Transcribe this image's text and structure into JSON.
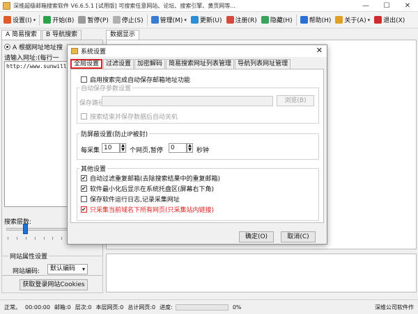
{
  "window": {
    "title": "深维超级邮箱搜索软件 V6.6.5.1 [试用版] 可搜索任意网站、论坛、搜索引擎、黄页网等...",
    "controls": [
      "—",
      "☐",
      "✕"
    ]
  },
  "toolbar": [
    {
      "label": "设置(I)",
      "icon": "settings-icon",
      "color": "#e05a2a",
      "dropdown": true
    },
    {
      "label": "开始(B)",
      "icon": "play-icon",
      "color": "#2aa34a",
      "dropdown": false
    },
    {
      "label": "暂停(P)",
      "icon": "pause-icon",
      "color": "#9a9a9a",
      "dropdown": false
    },
    {
      "label": "停止(S)",
      "icon": "stop-icon",
      "color": "#b0b0b0",
      "dropdown": false
    },
    {
      "label": "管理(M)",
      "icon": "manage-icon",
      "color": "#3a7bd5",
      "dropdown": true
    },
    {
      "label": "更新(U)",
      "icon": "update-icon",
      "color": "#2a8fd5",
      "dropdown": false
    },
    {
      "label": "注册(R)",
      "icon": "register-icon",
      "color": "#d54a3a",
      "dropdown": false
    },
    {
      "label": "隐藏(H)",
      "icon": "hide-icon",
      "color": "#3aa35a",
      "dropdown": false
    },
    {
      "label": "帮助(H)",
      "icon": "help-icon",
      "color": "#2a6fd5",
      "dropdown": false
    },
    {
      "label": "关于(A)",
      "icon": "about-icon",
      "color": "#e0a020",
      "dropdown": true
    },
    {
      "label": "退出(X)",
      "icon": "exit-icon",
      "color": "#d02a2a",
      "dropdown": false
    }
  ],
  "left": {
    "tabs": [
      "A 简易搜索",
      "B 导航搜索"
    ],
    "radio_label": "A 根据网址地址搜",
    "url_label": "请输入网址:(每行一",
    "url_value": "http://www.sunwill.",
    "depth_label": "搜索层数:",
    "depth_level": 0.2,
    "site_group_title": "网站属性设置",
    "encoding_label": "网站编码:",
    "encoding_value": "默认编码",
    "cookie_button": "获取登录网站Cookies"
  },
  "right": {
    "tab": "数据显示"
  },
  "status": {
    "ready": "正常。",
    "time": "00:00:00",
    "mailbox": "邮箱:0",
    "level": "层次:0",
    "page": "本层网页:0",
    "total": "总计网页:0",
    "progress_label": "进度:",
    "progress_value": "0%",
    "company": "深维公司软件作"
  },
  "dialog": {
    "title": "系统设置",
    "close": "✕",
    "tabs": [
      "全局设置",
      "过滤设置",
      "加密解码",
      "简易搜索网址列表管理",
      "导航列表网址管理"
    ],
    "auto_save_label": "启用搜索完成自动保存邮箱地址功能",
    "auto_save_checked": false,
    "params_group": "自动保存参数设置",
    "save_path_label": "保存路径:",
    "browse_button": "浏览(B)",
    "shutdown_label": "搜索结束并保存数据后自动关机",
    "anti_block_group": "防屏蔽设置(防止IP被封)",
    "per_collect_label": "每采集",
    "per_collect_value": "10",
    "pages_pause_label": "个网页,暂停",
    "pause_value": "0",
    "seconds_label": "秒钟",
    "other_group": "其他设置",
    "options": [
      {
        "label": "自动过滤重复邮箱(去除搜索结果中的重复邮箱)",
        "checked": true,
        "red": false
      },
      {
        "label": "软件最小化后显示在系统托盘区(屏幕右下角)",
        "checked": true,
        "red": false
      },
      {
        "label": "保存软件运行日志,记录采集网址",
        "checked": false,
        "red": false
      },
      {
        "label": "只采集当前域名下所有网页(只采集站内链接)",
        "checked": true,
        "red": true
      }
    ],
    "ok_button": "确定(O)",
    "cancel_button": "取消(C)"
  }
}
